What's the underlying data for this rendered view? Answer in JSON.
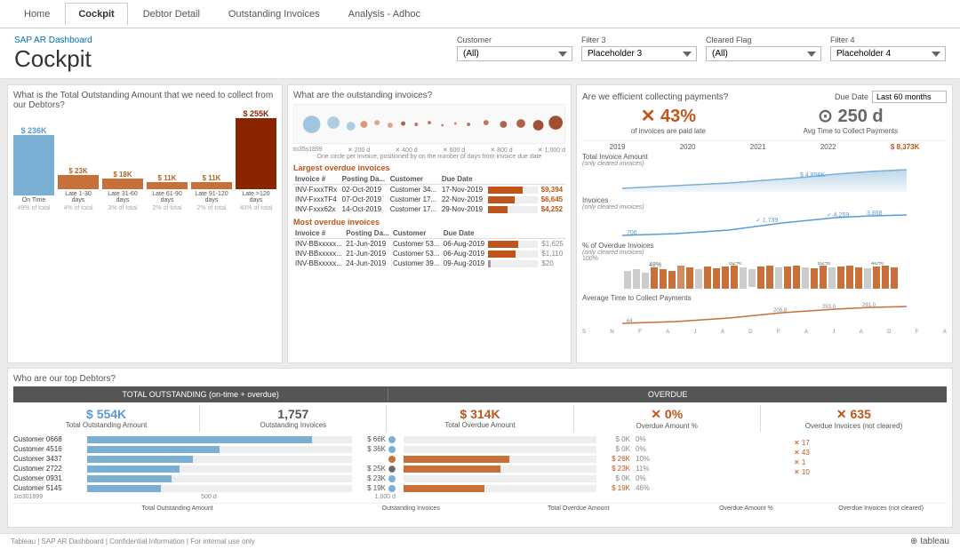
{
  "nav": {
    "tabs": [
      "Home",
      "Cockpit",
      "Debtor Detail",
      "Outstanding Invoices",
      "Analysis - Adhoc"
    ],
    "active": "Cockpit"
  },
  "header": {
    "subtitle": "SAP AR Dashboard",
    "title": "Cockpit",
    "filters": {
      "customer_label": "Customer",
      "customer_value": "(All)",
      "filter3_label": "Filter 3",
      "filter3_value": "Placeholder 3",
      "cleared_label": "Cleared Flag",
      "cleared_value": "(All)",
      "filter4_label": "Filter 4",
      "filter4_value": "Placeholder 4"
    }
  },
  "section_left": {
    "title": "What is the Total Outstanding Amount that we need to collect from our Debtors?",
    "bars": [
      {
        "label": "On Time",
        "sub": "49% of total",
        "value": "$ 236K",
        "height": 65,
        "color": "#7bafd4"
      },
      {
        "label": "Late 1-30 days",
        "sub": "4% of total",
        "value": "$ 23K",
        "height": 15,
        "color": "#b5651d"
      },
      {
        "label": "Late 31-60 days",
        "sub": "3% of total",
        "value": "$ 18K",
        "height": 12,
        "color": "#b5651d"
      },
      {
        "label": "Late 61-90 days",
        "sub": "2% of total",
        "value": "$ 11K",
        "height": 8,
        "color": "#b5651d"
      },
      {
        "label": "Late 91-120 days",
        "sub": "2% of total",
        "value": "$ 11K",
        "height": 8,
        "color": "#b5651d"
      },
      {
        "label": "Late >120 days",
        "sub": "40% of total",
        "value": "$ 255K",
        "height": 75,
        "color": "#8b2500"
      }
    ]
  },
  "section_mid": {
    "title": "What are the outstanding invoices?",
    "bubble_axis": [
      "to35s1899",
      "200 d",
      "400 d",
      "600 d",
      "800 d",
      "1,000 d"
    ],
    "largest_header": "Largest overdue invoices",
    "most_header": "Most overdue invoices",
    "largest_cols": [
      "Invoice #",
      "Posting Da...",
      "Customer",
      "Due Date",
      "",
      ""
    ],
    "largest_rows": [
      {
        "inv": "INV-FxxxTRx",
        "posting": "02-Oct-2019",
        "customer": "Customer 34...",
        "due": "17-Nov-2019",
        "val": "$9,394",
        "bar": 70
      },
      {
        "inv": "INV-FxxxTF4",
        "posting": "07-Oct-2019",
        "customer": "Customer 17...",
        "due": "22-Nov-2019",
        "val": "$6,645",
        "bar": 55
      },
      {
        "inv": "INV-Fxxx62x",
        "posting": "14-Oct-2019",
        "customer": "Customer 17...",
        "due": "29-Nov-2019",
        "val": "$4,252",
        "bar": 40
      }
    ],
    "most_cols": [
      "Invoice #",
      "Posting Da...",
      "Customer",
      "Due Date",
      "",
      ""
    ],
    "most_rows": [
      {
        "inv": "INV-BBxxxxx...",
        "posting": "21-Jun-2019",
        "customer": "Customer 53...",
        "due": "06-Aug-2019",
        "val": "$1,625",
        "bar": 60
      },
      {
        "inv": "INV-BBxxxxx...",
        "posting": "21-Jun-2019",
        "customer": "Customer 53...",
        "due": "06-Aug-2019",
        "val": "$1,110",
        "bar": 55
      },
      {
        "inv": "INV-BBxxxxx...",
        "posting": "24-Jun-2019",
        "customer": "Customer 39...",
        "due": "09-Aug-2019",
        "val": "$20",
        "bar": 5
      }
    ]
  },
  "section_right": {
    "title": "Are we efficient collecting payments?",
    "due_date_label": "Due Date",
    "due_date_filter": "Last 60 months",
    "kpi1_val": "43%",
    "kpi1_label": "of invoices are paid late",
    "kpi2_val": "250 d",
    "kpi2_label": "Avg Time to Collect Payments",
    "year_labels": [
      "2019",
      "2020",
      "2021",
      "2022"
    ],
    "chart1_label": "Total Invoice Amount",
    "chart1_sublabel": "(only cleared invoices)",
    "chart1_val": "$ 8,373K",
    "chart1_val2": "$ 4,858K",
    "chart2_label": "Invoices",
    "chart2_sublabel": "(only cleared invoices)",
    "chart2_vals": [
      "706",
      "1,739",
      "4,259",
      "3,868"
    ],
    "chart3_label": "% of Overdue Invoices",
    "chart3_sublabel": "(only cleared invoices)",
    "chart3_pct": "100%",
    "chart4_label": "Average Time to Collect Payments",
    "chart4_vals": [
      "64",
      "209.9",
      "253.0",
      "291.0"
    ],
    "bottom_axis": [
      "S",
      "N",
      "F",
      "A",
      "J",
      "A",
      "D",
      "F",
      "A",
      "J",
      "A",
      "D",
      "F",
      "A"
    ]
  },
  "section_debtors": {
    "title": "Who are our top Debtors?",
    "col1_header": "TOTAL OUTSTANDING (on-time + overdue)",
    "col2_header": "OVERDUE",
    "kpi_total_val": "$ 554K",
    "kpi_total_label": "Total Outstanding Amount",
    "kpi_inv_val": "1,757",
    "kpi_inv_label": "Outstanding Invoices",
    "kpi_overdue_val": "$ 314K",
    "kpi_overdue_label": "Total Overdue Amount",
    "kpi_pct_val": "✕ 0%",
    "kpi_pct_label": "Overdue Amount %",
    "kpi_notcleared_val": "✕ 635",
    "kpi_notcleared_label": "Overdue Invoices (not cleared)",
    "customers": [
      {
        "name": "Customer 0668",
        "tot_bar": 85,
        "tot_val": "$ 66K",
        "ov_bar": 0,
        "ov_val": "$ 0K",
        "pct": "0%",
        "nc": ""
      },
      {
        "name": "Customer 4516",
        "tot_bar": 45,
        "tot_val": "$ 36K",
        "ov_bar": 0,
        "ov_val": "$ 0K",
        "pct": "0%",
        "nc": ""
      },
      {
        "name": "Customer 3437",
        "tot_bar": 35,
        "tot_val": "",
        "ov_bar": 30,
        "ov_val": "$ 26K",
        "pct": "10%",
        "nc": "✕ 17"
      },
      {
        "name": "Customer 2722",
        "tot_bar": 30,
        "tot_val": "$ 25K",
        "ov_bar": 28,
        "ov_val": "$ 23K",
        "pct": "11%",
        "nc": "✕ 43"
      },
      {
        "name": "Customer 0931",
        "tot_bar": 28,
        "tot_val": "$ 23K",
        "ov_bar": 0,
        "ov_val": "$ 0K",
        "pct": "0%",
        "nc": "✕ 1"
      },
      {
        "name": "Customer 5145",
        "tot_bar": 22,
        "tot_val": "$ 19K",
        "ov_bar": 22,
        "ov_val": "$ 19K",
        "pct": "46%",
        "nc": "✕ 10"
      }
    ],
    "axis_labels": [
      "1to301899",
      "500 d",
      "1,000 d"
    ],
    "col_footers": [
      "Total Outstanding Amount",
      "Outstanding Invoices",
      "Total Overdue Amount",
      "Overdue Amount %",
      "Overdue Invoices (not cleared)"
    ]
  },
  "footer": {
    "text": "Tableau | SAP AR Dashboard | Confidential Information | For internal use only",
    "logo": "+ tableau"
  }
}
